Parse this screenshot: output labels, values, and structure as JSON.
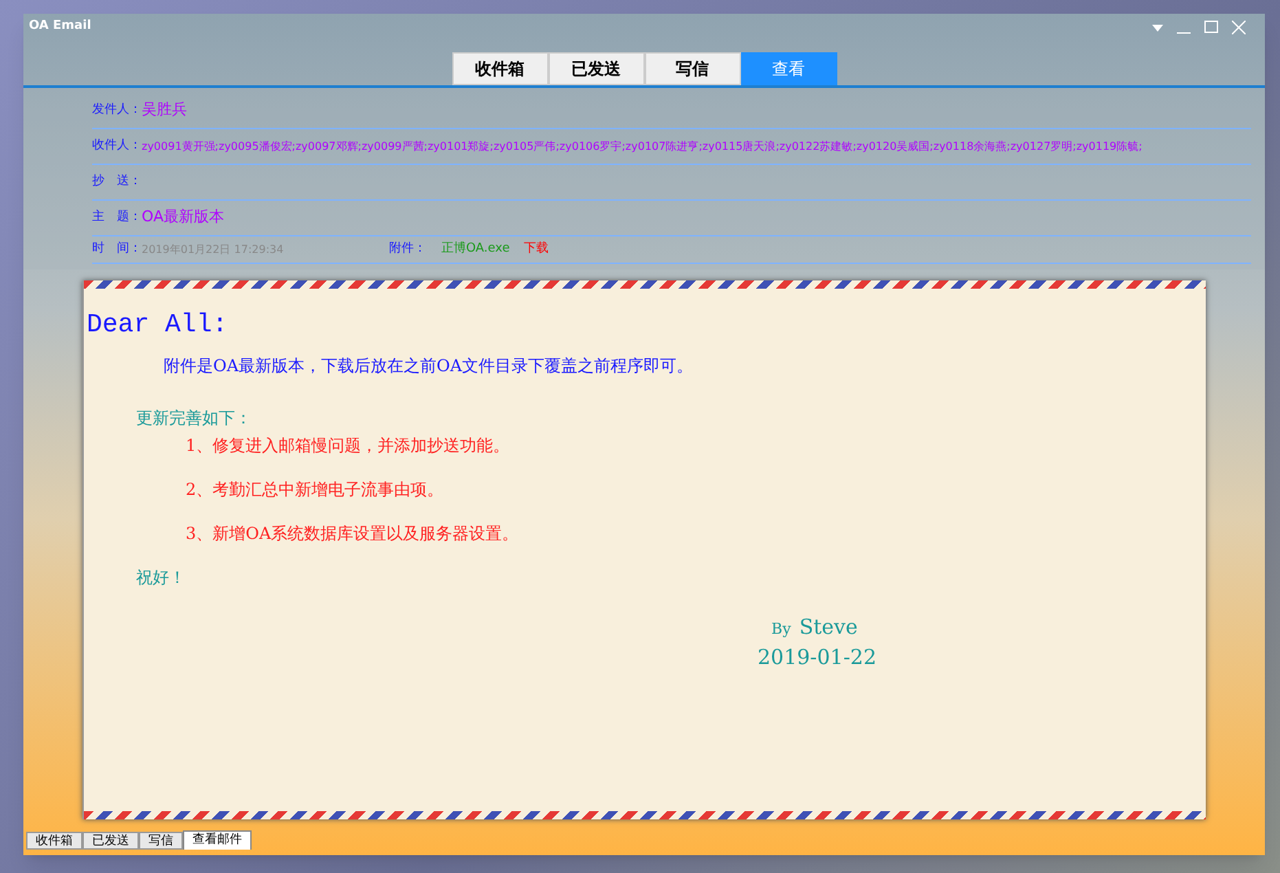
{
  "window": {
    "title": "OA Email"
  },
  "tabs": [
    {
      "label": "收件箱",
      "selected": false
    },
    {
      "label": "已发送",
      "selected": false
    },
    {
      "label": "写信",
      "selected": false
    },
    {
      "label": "查看",
      "selected": true
    }
  ],
  "header": {
    "fields": [
      {
        "label": "发件人：",
        "value": "吴胜兵"
      },
      {
        "label": "收件人：",
        "value": "zy0091黄开强;zy0095潘俊宏;zy0097邓辉;zy0099严茜;zy0101郑旋;zy0105严伟;zy0106罗宇;zy0107陈进亨;zy0115唐天浪;zy0122苏建敏;zy0120吴威国;zy0118余海燕;zy0127罗明;zy0119陈毓;"
      },
      {
        "label": "抄　送："
      },
      {
        "label": "主　题：",
        "value": "OA最新版本"
      }
    ],
    "time_label": "时　间：",
    "time": "2019年01月22日 17:29:34",
    "attachment_label": "附件：",
    "attachment": "正博OA.exe",
    "download": "下载"
  },
  "letter": {
    "greeting": "Dear All:",
    "intro": "附件是OA最新版本，下载后放在之前OA文件目录下覆盖之前程序即可。",
    "list_title": "更新完善如下：",
    "items": [
      "1、修复进入邮箱慢问题，并添加抄送功能。",
      "2、考勤汇总中新增电子流事由项。",
      "3、新增OA系统数据库设置以及服务器设置。"
    ],
    "closing": "祝好！",
    "by": "By",
    "author": "Steve",
    "date": "2019-01-22"
  },
  "bottom_tabs": [
    {
      "label": "收件箱",
      "selected": false
    },
    {
      "label": "已发送",
      "selected": false
    },
    {
      "label": "写信",
      "selected": false
    },
    {
      "label": "查看邮件",
      "selected": true
    }
  ]
}
